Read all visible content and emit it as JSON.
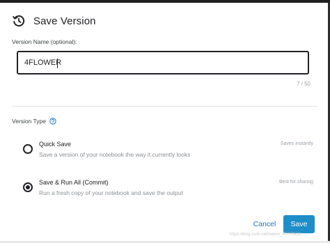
{
  "dialog": {
    "title": "Save Version"
  },
  "version_name": {
    "label": "Version Name (optional):",
    "value": "4FLOWER",
    "char_count": "7 / 50"
  },
  "version_type": {
    "label": "Version Type",
    "options": [
      {
        "title": "Quick Save",
        "description": "Save a version of your notebook the way it currently looks",
        "tag": "Saves instantly",
        "selected": false
      },
      {
        "title": "Save & Run All (Commit)",
        "description": "Run a fresh copy of your notebook and save the output",
        "tag": "Best for sharing",
        "selected": true
      }
    ]
  },
  "actions": {
    "cancel_label": "Cancel",
    "save_label": "Save"
  },
  "watermark": "https://blog.csdn.net/weixin_47770528",
  "colors": {
    "accent": "#1e8ec9",
    "link": "#1a73c8",
    "text": "#202124"
  },
  "icons": {
    "header": "history-icon",
    "help": "help-circle-icon"
  }
}
